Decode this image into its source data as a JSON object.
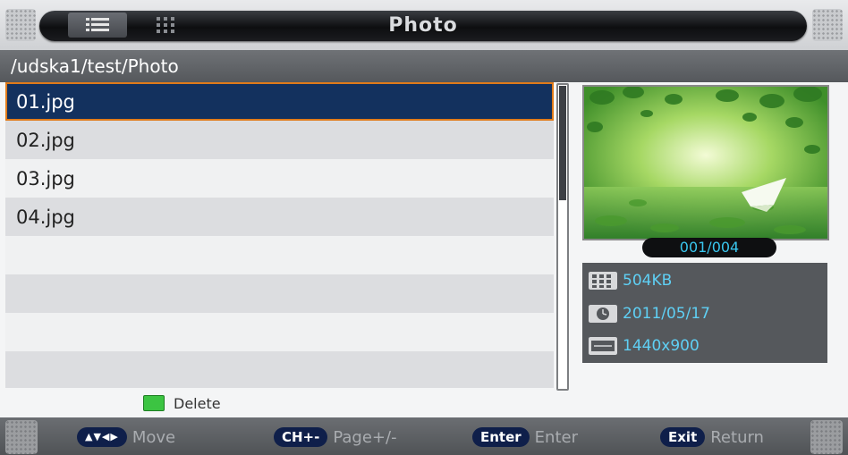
{
  "header": {
    "title": "Photo",
    "tabs": [
      {
        "icon": "list-view-icon",
        "active": true
      },
      {
        "icon": "grid-view-icon",
        "active": false
      }
    ]
  },
  "path": "/udska1/test/Photo",
  "files": [
    {
      "name": "01.jpg",
      "selected": true
    },
    {
      "name": "02.jpg",
      "selected": false
    },
    {
      "name": "03.jpg",
      "selected": false
    },
    {
      "name": "04.jpg",
      "selected": false
    }
  ],
  "preview": {
    "counter": "001/004"
  },
  "info": {
    "size": "504KB",
    "date": "2011/05/17",
    "resolution": "1440x900"
  },
  "hint": {
    "key_color": "#3cc442",
    "label": "Delete"
  },
  "footer": {
    "items": [
      {
        "key": "▲▼◀▶",
        "action": "Move"
      },
      {
        "key": "CH+-",
        "action": "Page+/-"
      },
      {
        "key": "Enter",
        "action": "Enter"
      },
      {
        "key": "Exit",
        "action": "Return"
      }
    ]
  },
  "colors": {
    "selection": "#13315e",
    "selection_border": "#e07b1a",
    "info_text": "#5fd0f5",
    "key_pill": "#0f1f4a"
  }
}
